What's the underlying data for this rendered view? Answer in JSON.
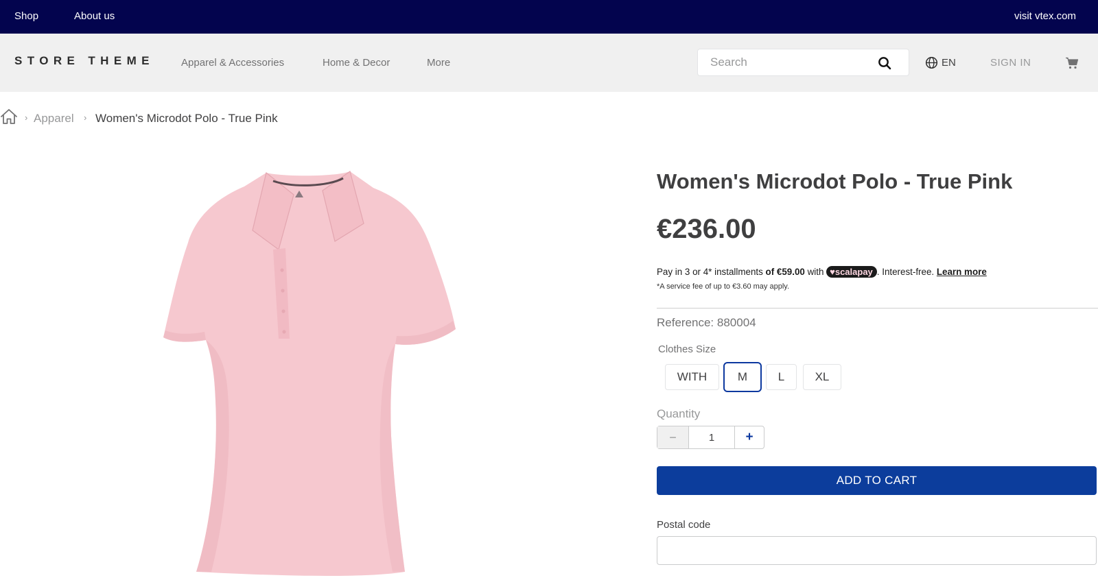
{
  "topbar": {
    "links": [
      "Shop",
      "About us"
    ],
    "external_link": "visit vtex.com",
    "background": "#03044e"
  },
  "header": {
    "logo": "STORE THEME",
    "nav": [
      "Apparel & Accessories",
      "Home & Decor",
      "More"
    ],
    "search_placeholder": "Search",
    "search_icon": "search-icon",
    "language": "EN",
    "language_icon": "globe-icon",
    "sign_in": "SIGN IN",
    "cart_icon": "cart-icon"
  },
  "breadcrumb": {
    "home_icon": "home-icon",
    "separator": "›",
    "category": "Apparel",
    "current": "Women's Microdot Polo - True Pink"
  },
  "product": {
    "title": "Women's Microdot Polo - True Pink",
    "price": "€236.00",
    "installments": {
      "prefix": "Pay in 3 or 4* installments ",
      "amount": "of €59.00",
      "with": " with ",
      "provider": "scalapay",
      "suffix": ". Interest-free. ",
      "learn_more": "Learn more",
      "fee_note": "*A service fee of up to €3.60 may apply."
    },
    "reference": "Reference: 880004",
    "size_label": "Clothes Size",
    "sizes": [
      "WITH",
      "M",
      "L",
      "XL"
    ],
    "selected_size": "M",
    "quantity_label": "Quantity",
    "quantity": "1",
    "minus": "−",
    "plus": "+",
    "add_to_cart": "ADD TO CART",
    "postal_label": "Postal code",
    "postal_value": ""
  },
  "colors": {
    "accent": "#0c3d9c",
    "selected_border": "#0c389f",
    "product_pink": "#f5c4cc"
  }
}
